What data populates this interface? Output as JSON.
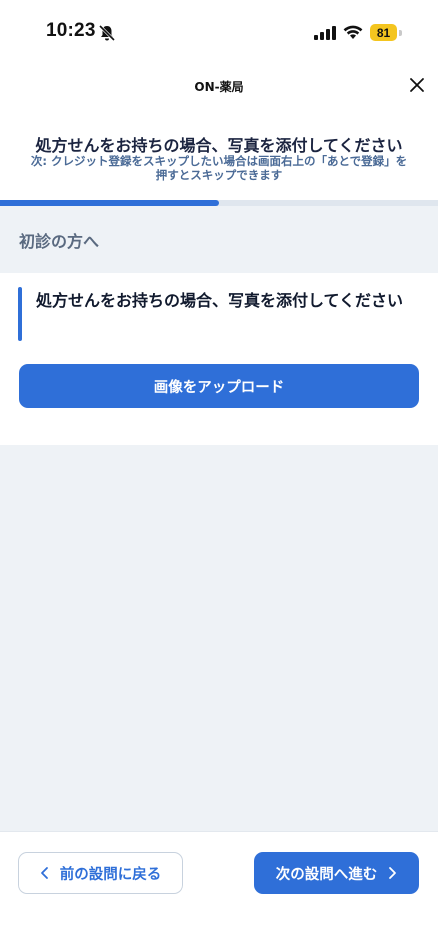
{
  "status_bar": {
    "time": "10:23",
    "battery_level": "81",
    "icons": [
      "bell-slash-icon",
      "signal-icon",
      "wifi-icon",
      "battery-icon"
    ]
  },
  "nav": {
    "title": "ON-薬局",
    "close_icon": "close-icon"
  },
  "question": {
    "title": "処方せんをお持ちの場合、写真を添付してください",
    "hint_line1": "次: クレジット登録をスキップしたい場合は画面右上の「あとで登録」を",
    "hint_line2": "押すとスキップできます"
  },
  "progress": {
    "fraction": 0.5
  },
  "section": {
    "title": "初診の方へ"
  },
  "card": {
    "question_text": "処方せんをお持ちの場合、写真を添付してください",
    "upload_label": "画像をアップロード"
  },
  "footer": {
    "prev_label": "前の設問に戻る",
    "next_label": "次の設問へ進む"
  },
  "colors": {
    "accent": "#2f6fd8",
    "hint": "#4a6a96",
    "background": "#eef2f6",
    "battery": "#f4c51f"
  }
}
